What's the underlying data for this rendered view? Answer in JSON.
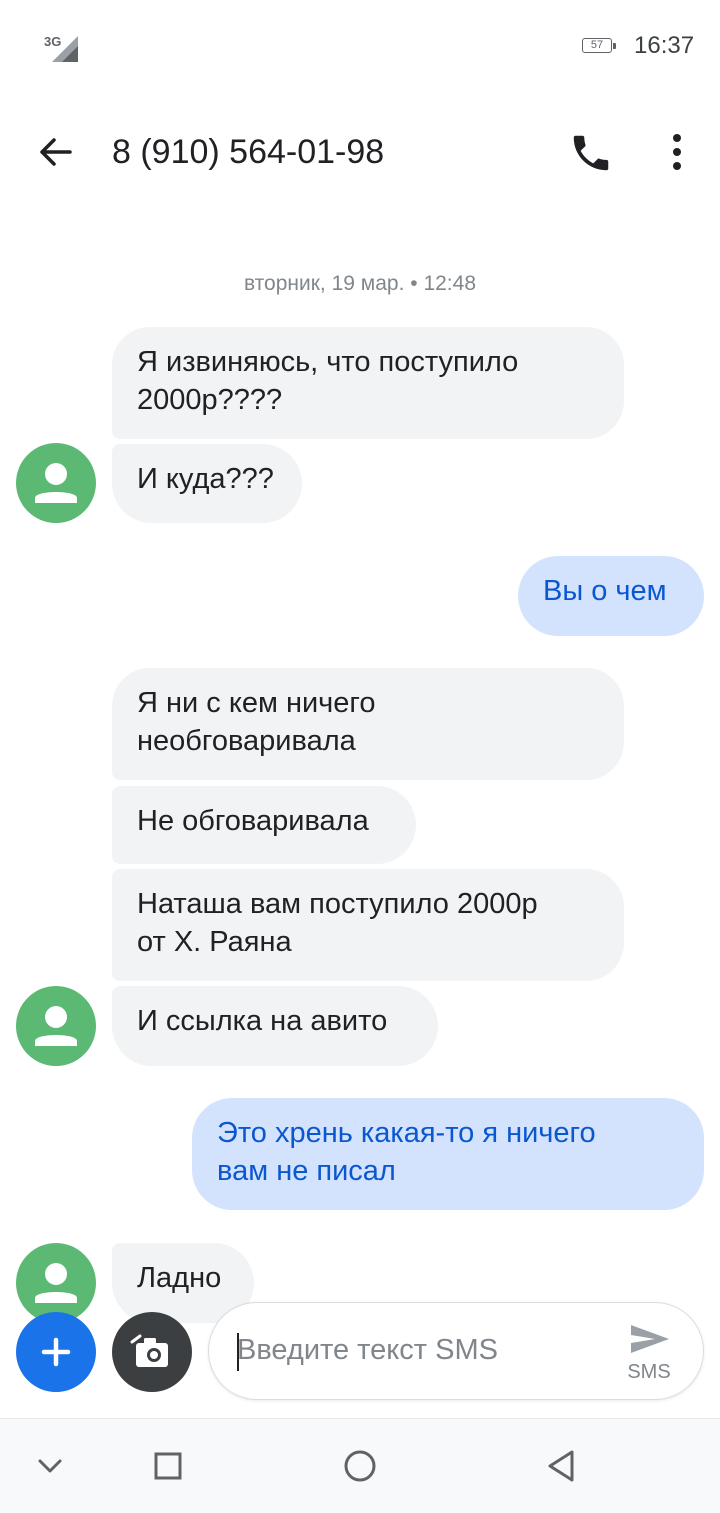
{
  "status_bar": {
    "network": "3G",
    "battery": "57",
    "time": "16:37"
  },
  "app_bar": {
    "title": "8 (910) 564-01-98",
    "icons": [
      "back-arrow-icon",
      "phone-icon",
      "more-vert-icon"
    ]
  },
  "conversation": {
    "timestamp": "вторник, 19 мар. • 12:48",
    "messages": [
      {
        "direction": "incoming",
        "line1": "Я извиняюсь, что поступило",
        "line2": "2000р????"
      },
      {
        "direction": "incoming",
        "line1": "И куда???"
      },
      {
        "direction": "outgoing",
        "line1": "Вы о чем"
      },
      {
        "direction": "incoming",
        "line1": "Я ни с кем ничего",
        "line2": "необговаривала"
      },
      {
        "direction": "incoming",
        "line1": "Не обговаривала"
      },
      {
        "direction": "incoming",
        "line1": "Наташа вам поступило 2000р",
        "line2": "от Х. Раяна"
      },
      {
        "direction": "incoming",
        "line1": "И ссылка на авито"
      },
      {
        "direction": "outgoing",
        "line1": "Это хрень какая-то я ничего",
        "line2": "вам не писал"
      },
      {
        "direction": "incoming",
        "line1": "Ладно"
      }
    ]
  },
  "composer": {
    "placeholder": "Введите текст SMS",
    "value": "",
    "send_label": "SMS"
  },
  "colors": {
    "incoming_bubble": "#f1f3f4",
    "outgoing_bubble": "#d3e3fd",
    "outgoing_text": "#0b57d0",
    "avatar": "#5bb974",
    "fab": "#1a73e8"
  },
  "nav_bar": {
    "icons": [
      "chevron-down-icon",
      "recents-square-icon",
      "home-circle-icon",
      "back-triangle-icon"
    ]
  }
}
